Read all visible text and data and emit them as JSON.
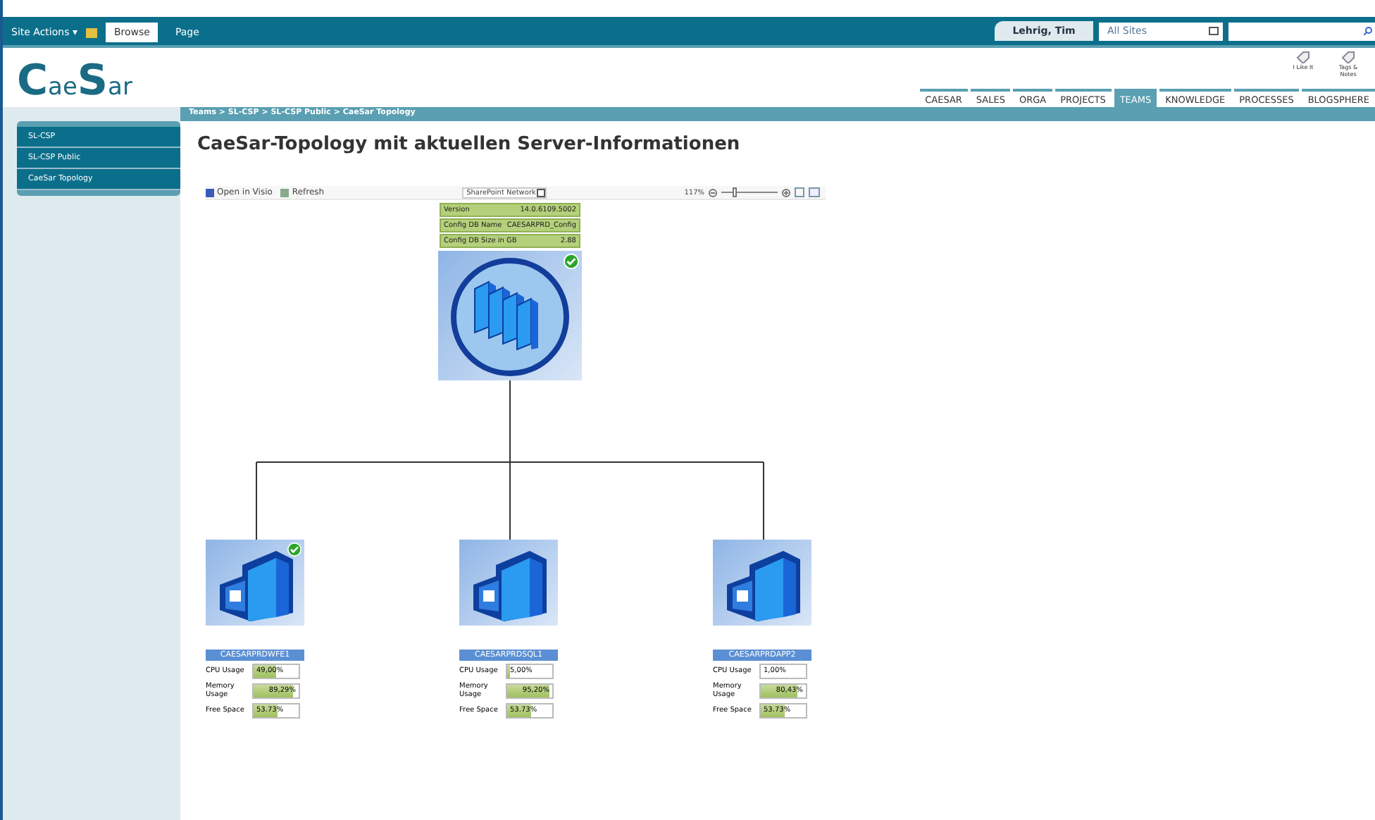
{
  "ribbon": {
    "site_actions": "Site Actions",
    "site_actions_caret": "▾",
    "tabs": [
      {
        "label": "Browse",
        "selected": true
      },
      {
        "label": "Page",
        "selected": false
      }
    ],
    "user": "Lehrig, Tim",
    "scope": "All Sites"
  },
  "logo": {
    "parts": [
      "C",
      "ae",
      "S",
      "ar"
    ]
  },
  "social": [
    {
      "label": "I Like It"
    },
    {
      "label": "Tags & Notes"
    }
  ],
  "nav_tabs": [
    {
      "label": "CAESAR",
      "selected": false
    },
    {
      "label": "SALES",
      "selected": false
    },
    {
      "label": "ORGA",
      "selected": false
    },
    {
      "label": "PROJECTS",
      "selected": false
    },
    {
      "label": "TEAMS",
      "selected": true
    },
    {
      "label": "KNOWLEDGE",
      "selected": false
    },
    {
      "label": "PROCESSES",
      "selected": false
    },
    {
      "label": "BLOGSPHERE",
      "selected": false
    }
  ],
  "breadcrumb": "Teams > SL-CSP > SL-CSP Public > CaeSar Topology",
  "sidebar": {
    "items": [
      {
        "label": "SL-CSP"
      },
      {
        "label": "SL-CSP Public"
      },
      {
        "label": "CaeSar Topology"
      }
    ]
  },
  "page_title": "CaeSar-Topology mit aktuellen Server-Informationen",
  "toolbar": {
    "open": "Open in Visio",
    "refresh": "Refresh",
    "view": "SharePoint Network",
    "zoom": "117%",
    "level": 0.25
  },
  "farm": {
    "ok": true,
    "info": [
      {
        "label": "Version",
        "value": "14.0.6109.5002"
      },
      {
        "label": "Config DB Name",
        "value": "CAESARPRD_Config"
      },
      {
        "label": "Config DB Size in GB",
        "value": "2.88"
      }
    ]
  },
  "servers": [
    {
      "name": "CAESARPRDWFE1",
      "ok": true,
      "metrics": [
        {
          "label": "CPU Usage",
          "reading": "49,00%",
          "level": 0.49
        },
        {
          "label": "Memory Usage",
          "reading": "89,29%",
          "level": 0.89
        },
        {
          "label": "Free Space",
          "reading": "53.73%",
          "level": 0.54
        }
      ]
    },
    {
      "name": "CAESARPRDSQL1",
      "ok": false,
      "metrics": [
        {
          "label": "CPU Usage",
          "reading": "5,00%",
          "level": 0.05
        },
        {
          "label": "Memory Usage",
          "reading": "95,20%",
          "level": 0.95
        },
        {
          "label": "Free Space",
          "reading": "53.73%",
          "level": 0.54
        }
      ]
    },
    {
      "name": "CAESARPRDAPP2",
      "ok": false,
      "metrics": [
        {
          "label": "CPU Usage",
          "reading": "1,00%",
          "level": 0.01
        },
        {
          "label": "Memory Usage",
          "reading": "80,43%",
          "level": 0.8
        },
        {
          "label": "Free Space",
          "reading": "53.73%",
          "level": 0.54
        }
      ]
    }
  ]
}
